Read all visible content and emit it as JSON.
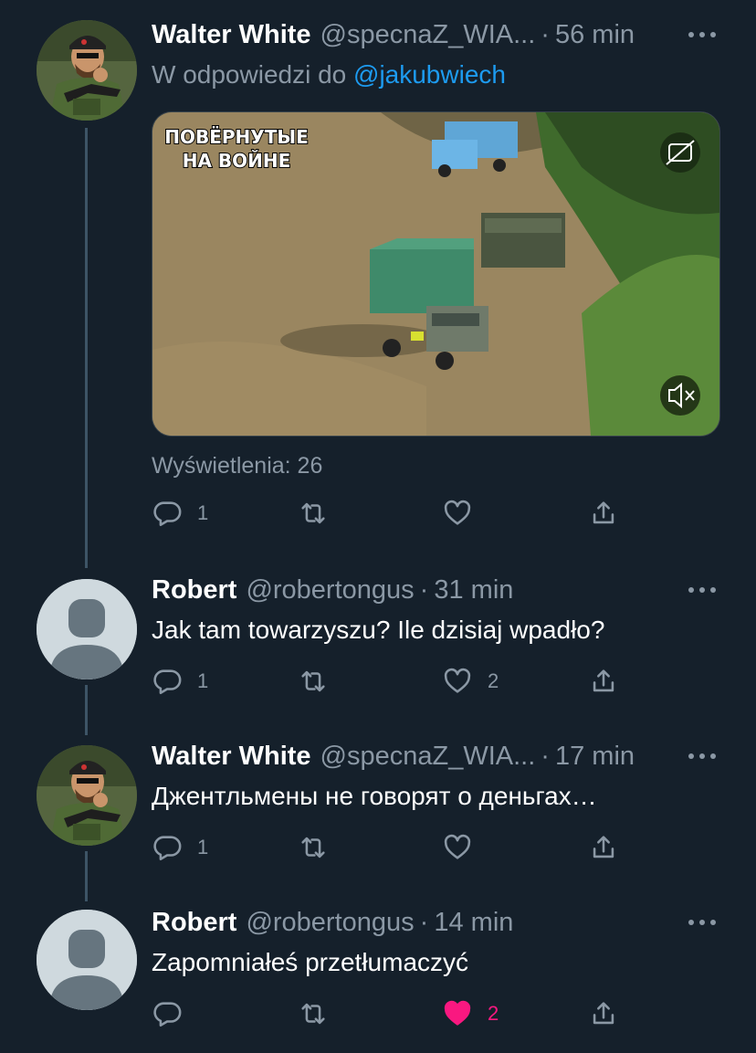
{
  "tweets": [
    {
      "name": "Walter White",
      "handle": "@specnaZ_WIA...",
      "time": "56 min",
      "reply_prefix": "W odpowiedzi do",
      "reply_mention": "@jakubwiech",
      "video_caption_line1": "ПОВЁРНУТЫЕ",
      "video_caption_line2": "НА ВОЙНЕ",
      "views": "Wyświetlenia: 26",
      "reply_count": "1",
      "retweet_count": "",
      "like_count": "",
      "liked": false
    },
    {
      "name": "Robert",
      "handle": "@robertongus",
      "time": "31 min",
      "text": "Jak tam towarzyszu? Ile dzisiaj wpadło?",
      "reply_count": "1",
      "retweet_count": "",
      "like_count": "2",
      "liked": false
    },
    {
      "name": "Walter White",
      "handle": "@specnaZ_WIA...",
      "time": "17 min",
      "text": "Джентльмены не говорят о деньгах…",
      "reply_count": "1",
      "retweet_count": "",
      "like_count": "",
      "liked": false
    },
    {
      "name": "Robert",
      "handle": "@robertongus",
      "time": "14 min",
      "text": "Zapomniałeś przetłumaczyć",
      "reply_count": "",
      "retweet_count": "",
      "like_count": "2",
      "liked": true
    }
  ],
  "separator": "·",
  "icons": [
    "reply-icon",
    "retweet-icon",
    "like-icon",
    "share-icon",
    "more-icon",
    "captions-icon",
    "mute-icon"
  ],
  "colors": {
    "background": "#15202b",
    "muted": "#8b98a5",
    "link": "#1d9bf0",
    "like": "#f91880",
    "thread": "#3d5466"
  }
}
